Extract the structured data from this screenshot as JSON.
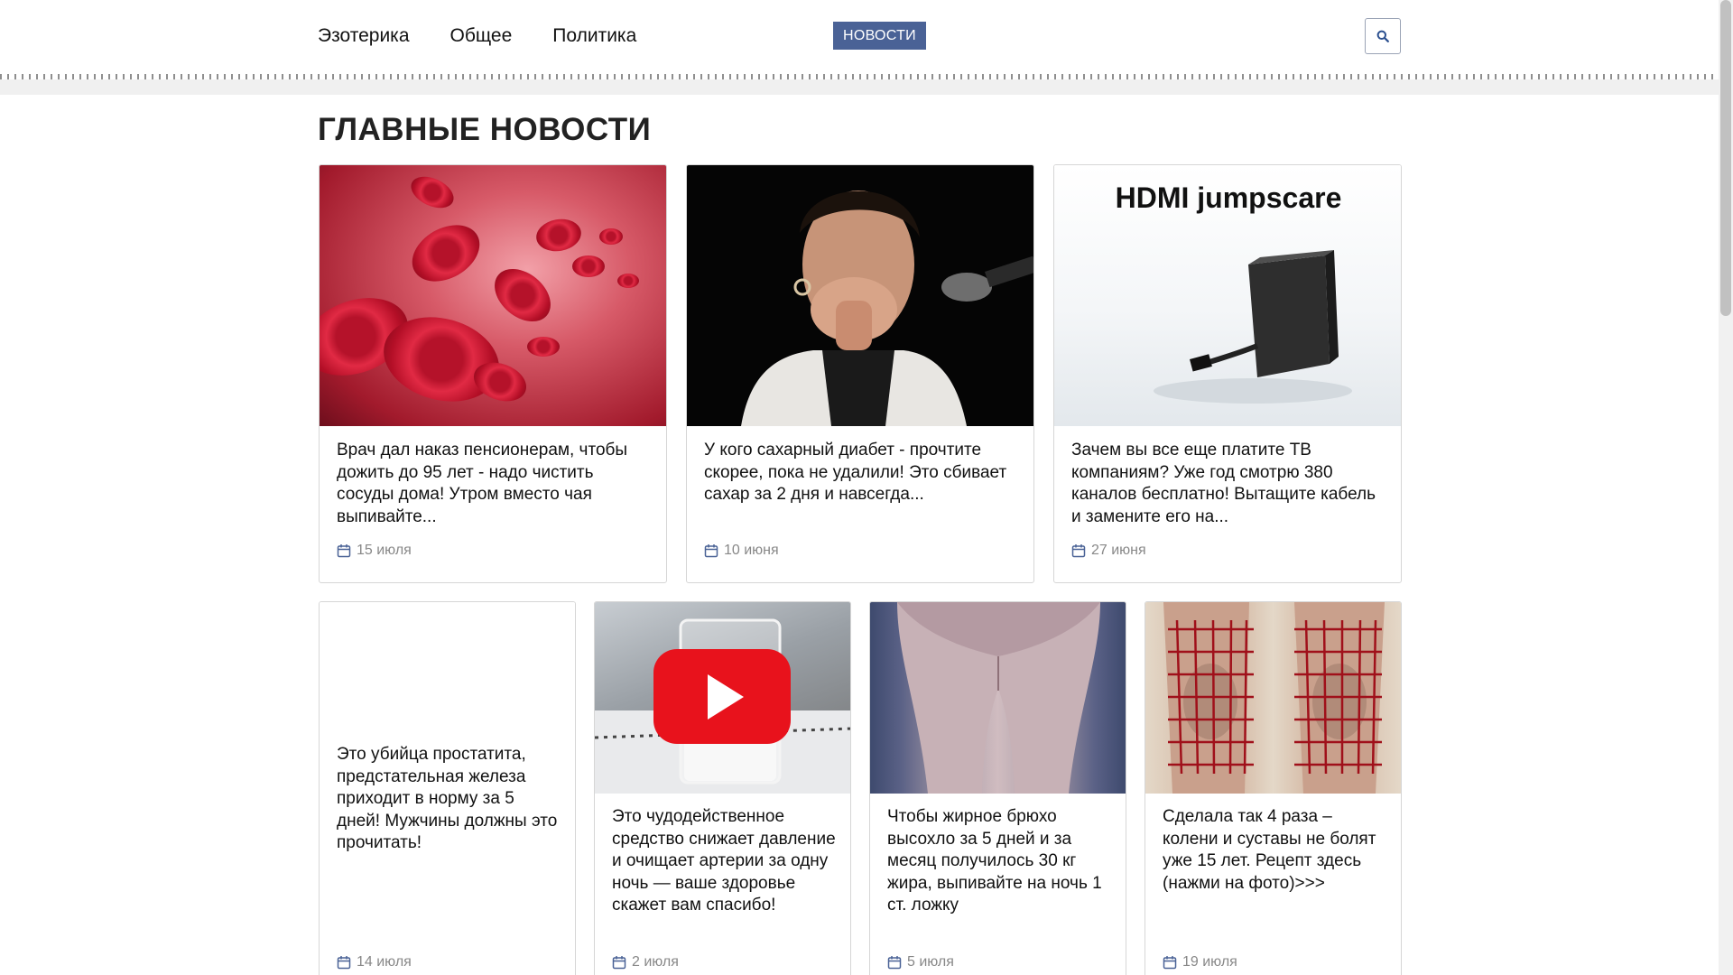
{
  "nav": {
    "items": [
      "Эзотерика",
      "Общее",
      "Политика"
    ],
    "news_button": "НОВОСТИ"
  },
  "section": {
    "title": "ГЛАВНЫЕ НОВОСТИ"
  },
  "cards_top": [
    {
      "title": "Врач дал наказ пенсионерам, чтобы дожить до 95 лет - надо чистить сосуды дома! Утром вместо чая выпивайте...",
      "date": "15 июля",
      "image": "red-blood-cells"
    },
    {
      "title": "У кого сахарный диабет - прочтите скорее, пока не удалили! Это сбивает сахар за 2 дня и навсегда...",
      "date": "10 июня",
      "image": "surprised-woman-microphone"
    },
    {
      "title": "Зачем вы все еще платите ТВ компаниям? Уже год смотрю 380 каналов бесплатно! Вытащите кабель и замените его на...",
      "date": "27 июня",
      "image": "hdmi-device",
      "image_caption": "HDMI jumpscare"
    }
  ],
  "cards_bottom": [
    {
      "title": "Это убийца простатита, предстательная железа приходит в норму за 5 дней! Мужчины должны это прочитать!",
      "date": "14 июля",
      "image": "blank"
    },
    {
      "title": "Это чудодейственное средство снижает давление и очищает артерии за одну ночь — ваше здоровье скажет вам спасибо!",
      "date": "2 июля",
      "image": "glass-with-play-button"
    },
    {
      "title": "Чтобы жирное брюхо высохло за 5 дней и за месяц получилось 30 кг жира, выпивайте на ночь 1 ст. ложку",
      "date": "5 июля",
      "image": "legs-thighs"
    },
    {
      "title": "Сделала так 4 раза – колени и суставы не болят уже 15 лет. Рецепт здесь (нажми на фото)>>>",
      "date": "19 июля",
      "image": "knees-grid"
    }
  ],
  "colors": {
    "accent": "#4a6296",
    "date": "#888888",
    "border": "#d6d6d6"
  },
  "icons": {
    "search": "search-icon",
    "calendar": "calendar-icon"
  }
}
